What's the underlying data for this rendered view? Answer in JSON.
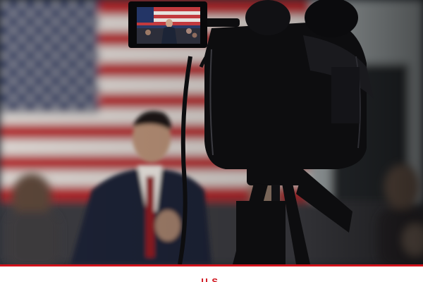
{
  "photo": {
    "subject": "news-photo",
    "colors": {
      "flag_red": "#b0262c",
      "flag_white": "#d9d4d0",
      "flag_blue": "#1f2f5a",
      "camera_black": "#0d0d0f",
      "wall": "#9aa3a6"
    }
  },
  "section": {
    "label": "U.S.",
    "accent": "#d0121b"
  }
}
